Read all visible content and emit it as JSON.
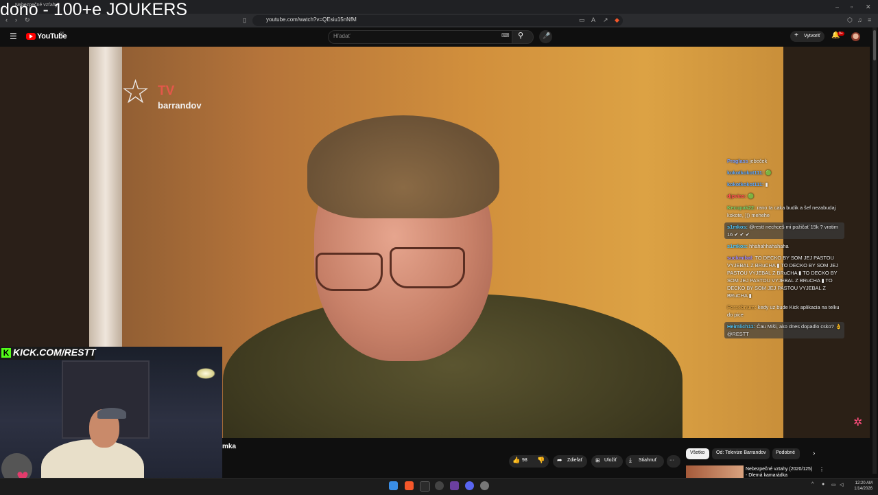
{
  "overlay_title": "dono - 100+e JOUKERS",
  "browser": {
    "tab_title": "Nebezpečné vzťahy",
    "url": "youtube.com/watch?v=QEsiu15nNfM"
  },
  "youtube": {
    "logo_text": "YouTube",
    "country_code": "SK",
    "search_placeholder": "Hľadať",
    "create_label": "Vytvoriť",
    "notifications": "9+"
  },
  "video": {
    "channel_logo_tv": "TV",
    "channel_logo_text": "barrandov",
    "title_partial": "mka"
  },
  "stream_overlay": {
    "kick_url": "KICK.COM/RESTT"
  },
  "chat": [
    {
      "user": "Praglass",
      "user_color": "#7aa0ff",
      "text": "jebeček",
      "highlight": false
    },
    {
      "user": "kokotkokot111:",
      "user_color": "#5aa6ff",
      "text": "🟢",
      "highlight": false
    },
    {
      "user": "kokotkokot111:",
      "user_color": "#5aa6ff",
      "text": "▮",
      "highlight": false
    },
    {
      "user": "djpvias:",
      "user_color": "#ff4d4d",
      "text": "🟢",
      "highlight": false
    },
    {
      "user": "Kecupak22:",
      "user_color": "#7ad26a",
      "text": "rano ta caka budik a šef nezabudaj kokote, ))) mehehe",
      "highlight": false
    },
    {
      "user": "s1mkos:",
      "user_color": "#4fc3f7",
      "text": "@restt nechceš mi požičať 15k ? vratim 16 ✔ ✔ ✔",
      "highlight": true
    },
    {
      "user": "s1mkos:",
      "user_color": "#4fc3f7",
      "text": "hhahahhahahaha",
      "highlight": false
    },
    {
      "user": "suckmibal:",
      "user_color": "#9b86ff",
      "text": "TO DECKO BY SOM JEJ PASTOU VYJEBAL Z BRuCHA ▮ TO DECKO BY SOM JEJ PASTOU VYJEBAL Z BRuCHA ▮ TO DECKO BY SOM JEJ PASTOU VYJEBAL Z BRuCHA ▮ TO DECKO BY SOM JEJ PASTOU VYJEBAL Z BRuCHA ▮",
      "highlight": false
    },
    {
      "user": "Forsebnum:",
      "user_color": "#e0a040",
      "text": "kedy uz bude Kick aplikacia na telku do pice",
      "highlight": false
    },
    {
      "user": "Heimlich11:",
      "user_color": "#4fc3f7",
      "text": "Čau Miši, ako dnes dopadlo csko? 👌 @RESTT",
      "highlight": true
    }
  ],
  "actions": {
    "likes": "98",
    "share": "Zdieľať",
    "save": "Uložiť",
    "download": "Stiahnuť",
    "more": "···"
  },
  "chips": [
    "Všetko",
    "Od: Televize Barrandov",
    "Podobné"
  ],
  "recommendation": {
    "title": "Nebezpečné vztahy (2020/125) - Dlemá kamarádka"
  },
  "taskbar": {
    "time": "12:20 AM",
    "date": "1/14/2026"
  }
}
